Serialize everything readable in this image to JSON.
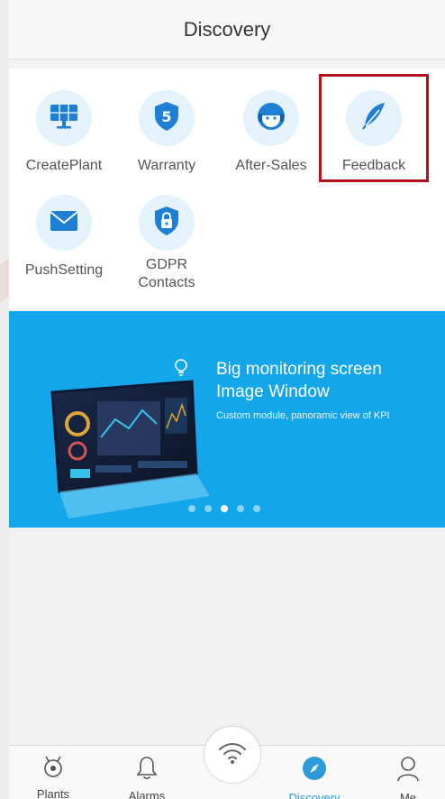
{
  "header": {
    "title": "Discovery"
  },
  "tiles": [
    {
      "label": "CreatePlant",
      "icon": "solar-panel-icon"
    },
    {
      "label": "Warranty",
      "icon": "shield-five-icon"
    },
    {
      "label": "After-Sales",
      "icon": "support-agent-icon"
    },
    {
      "label": "Feedback",
      "icon": "feather-icon"
    },
    {
      "label": "PushSetting",
      "icon": "envelope-icon"
    },
    {
      "label": "GDPR\nContacts",
      "icon": "lock-shield-icon"
    }
  ],
  "banner": {
    "title_line1": "Big monitoring screen",
    "title_line2": "Image Window",
    "subtitle": "Custom module, panoramic view of KPI",
    "page_count": 5,
    "active_page": 3
  },
  "tabbar": {
    "tabs": [
      {
        "label": "Plants",
        "icon": "plant-icon"
      },
      {
        "label": "Alarms",
        "icon": "bell-icon"
      },
      {
        "label": "Discovery",
        "icon": "compass-icon"
      },
      {
        "label": "Me",
        "icon": "person-icon"
      }
    ],
    "center_icon": "wifi-icon"
  },
  "colors": {
    "accent": "#2d9bd8",
    "banner_bg": "#14a6ea",
    "highlight_border": "#b3121a",
    "icon_circle_bg": "#e4f2fb"
  }
}
